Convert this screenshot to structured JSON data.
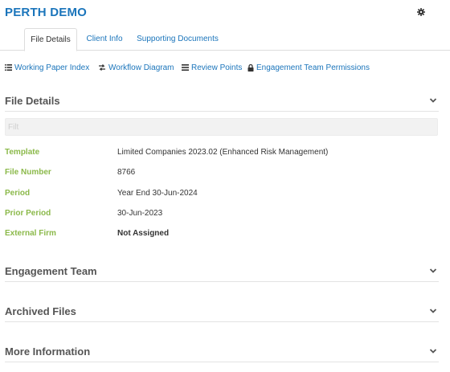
{
  "header": {
    "title": "PERTH DEMO",
    "settings_icon": "gear-icon"
  },
  "tabs": [
    {
      "label": "File Details",
      "active": true
    },
    {
      "label": "Client Info",
      "active": false
    },
    {
      "label": "Supporting Documents",
      "active": false
    }
  ],
  "toolbar": {
    "links": [
      {
        "label": "Working Paper Index",
        "icon": "list-icon"
      },
      {
        "label": "Workflow Diagram",
        "icon": "workflow-icon"
      },
      {
        "label": "Review Points",
        "icon": "review-points-icon"
      },
      {
        "label": "Engagement Team Permissions",
        "icon": "lock-icon"
      }
    ]
  },
  "file_details": {
    "heading": "File Details",
    "filter_placeholder": "Filt",
    "rows": [
      {
        "label": "Template",
        "value": "Limited Companies 2023.02 (Enhanced Risk Management)"
      },
      {
        "label": "File Number",
        "value": "8766"
      },
      {
        "label": "Period",
        "value": "Year End 30-Jun-2024"
      },
      {
        "label": "Prior Period",
        "value": "30-Jun-2023"
      },
      {
        "label": "External Firm",
        "value": "Not Assigned"
      }
    ]
  },
  "sections": [
    {
      "heading": "Engagement Team"
    },
    {
      "heading": "Archived Files"
    },
    {
      "heading": "More Information"
    }
  ],
  "colors": {
    "accent": "#1b75bb",
    "label_green": "#8bb94a",
    "heading_gray": "#555555"
  }
}
